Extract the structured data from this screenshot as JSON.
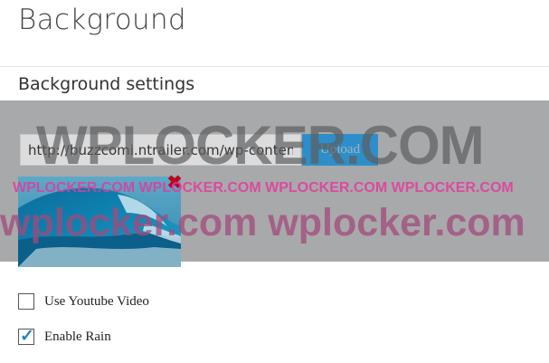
{
  "page": {
    "title": "Background",
    "section_heading": "Background settings"
  },
  "background": {
    "image_url": "http://buzzcomi.ntrailer.com/wp-content",
    "upload_label": "Upload",
    "remove_symbol": "✖",
    "preview_image": "ocean-wave"
  },
  "watermarks": {
    "big": "WPLOCKER.COM",
    "mid": "WPLOCKER.COM WPLOCKER.COM WPLOCKER.COM WPLOCKER.COM",
    "low": "wplocker.com wplocker.com"
  },
  "options": [
    {
      "label": "Use Youtube Video",
      "checked": false
    },
    {
      "label": "Enable Rain",
      "checked": true
    }
  ],
  "colors": {
    "band": "#a8a9ab",
    "upload": "#2e8ec9",
    "remove": "#c4001a",
    "check": "#1f86c8",
    "watermark_pink": "#e43a9e"
  }
}
